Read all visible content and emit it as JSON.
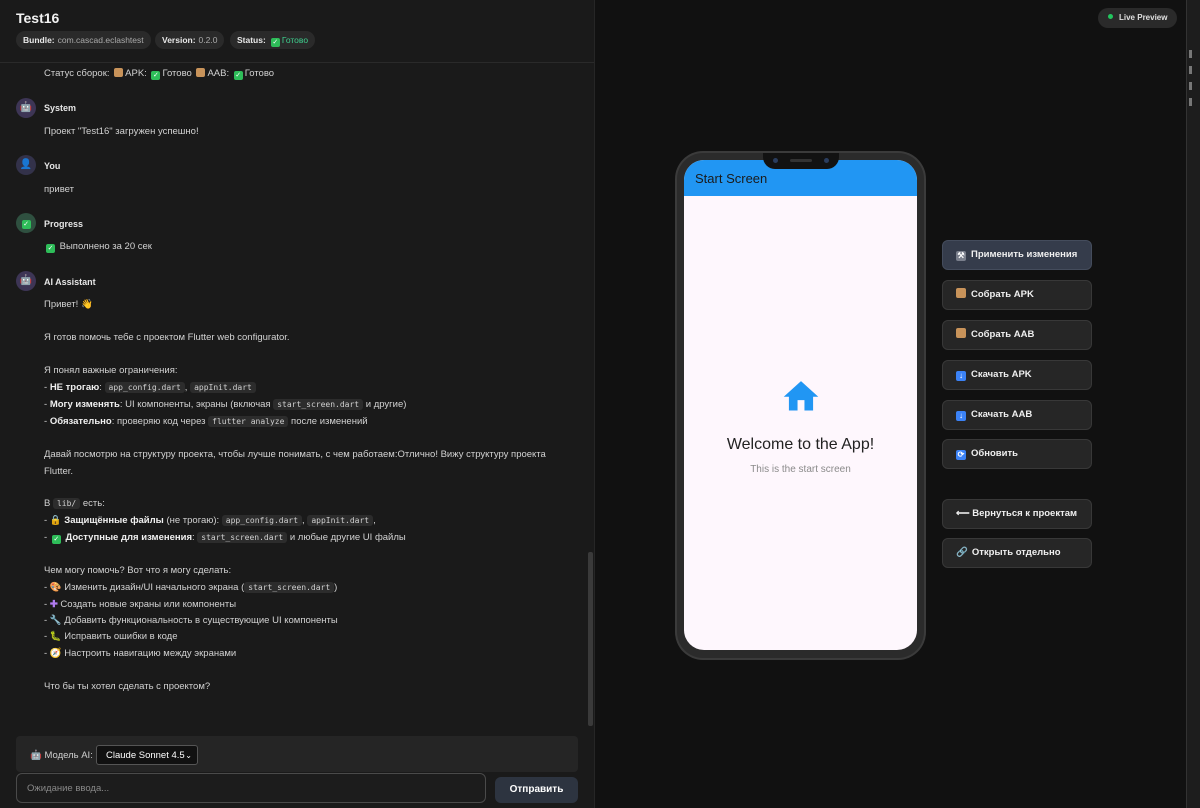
{
  "header": {
    "title": "Test16",
    "bundle_label": "Bundle:",
    "bundle_value": "com.cascad.eclashtest",
    "version_label": "Version:",
    "version_value": "0.2.0",
    "status_label": "Status:",
    "status_value": "Готово"
  },
  "chat": {
    "build_status": {
      "prefix": "Статус сборок:",
      "apk": "APK:",
      "apk_state": "Готово",
      "aab": "AAB:",
      "aab_state": "Готово"
    },
    "messages": [
      {
        "sender": "System",
        "text": "Проект \"Test16\" загружен успешно!"
      },
      {
        "sender": "You",
        "text": "привет"
      },
      {
        "sender": "Progress",
        "text": "Выполнено за 20 сек"
      },
      {
        "sender": "AI Assistant"
      }
    ],
    "ai": {
      "greeting": "Привет!",
      "intro": "Я готов помочь тебе с проектом Flutter web configurator.",
      "constraints_head": "Я понял важные ограничения:",
      "c1_bold": "НЕ трогаю",
      "c1_code1": "app_config.dart",
      "c1_code2": "appInit.dart",
      "c2_bold": "Могу изменять",
      "c2_text": ": UI компоненты, экраны (включая",
      "c2_code": "start_screen.dart",
      "c2_tail": "и другие)",
      "c3_bold": "Обязательно",
      "c3_text": ": проверяю код через",
      "c3_code": "flutter analyze",
      "c3_tail": "после изменений",
      "look_line1": "Давай посмотрю на структуру проекта, чтобы лучше понимать, с чем работаем:Отлично! Вижу структуру проекта",
      "look_line2": "Flutter.",
      "in_prefix": "В",
      "in_code": "lib/",
      "in_suffix": "есть:",
      "p1_bold": "Защищённые файлы",
      "p1_text": "(не трогаю):",
      "p1_code1": "app_config.dart",
      "p1_code2": "appInit.dart",
      "p2_bold": "Доступные для изменения",
      "p2_code": "start_screen.dart",
      "p2_tail": "и любые другие UI файлы",
      "help_head": "Чем могу помочь? Вот что я могу сделать:",
      "h1_text": "Изменить дизайн/UI начального экрана (",
      "h1_code": "start_screen.dart",
      "h2": "Создать новые экраны или компоненты",
      "h3": "Добавить функциональность в существующие UI компоненты",
      "h4": "Исправить ошибки в коде",
      "h5": "Настроить навигацию между экранами",
      "question": "Что бы ты хотел сделать с проектом?"
    }
  },
  "composer": {
    "model_label": "Модель AI:",
    "model_value": "Claude Sonnet 4.5",
    "input_placeholder": "Ожидание ввода...",
    "send_label": "Отправить"
  },
  "preview": {
    "badge": "Live Preview",
    "appbar_title": "Start Screen",
    "welcome": "Welcome to the App!",
    "subtitle": "This is the start screen"
  },
  "actions": {
    "apply": "Применить изменения",
    "build_apk": "Собрать APK",
    "build_aab": "Собрать AAB",
    "download_apk": "Скачать APK",
    "download_aab": "Скачать AAB",
    "refresh": "Обновить",
    "back": "Вернуться к проектам",
    "open_separately": "Открыть отдельно"
  },
  "colors": {
    "accent_blue": "#2196f3",
    "status_green": "#3ecf8e",
    "preview_bg": "#fef7fd"
  }
}
